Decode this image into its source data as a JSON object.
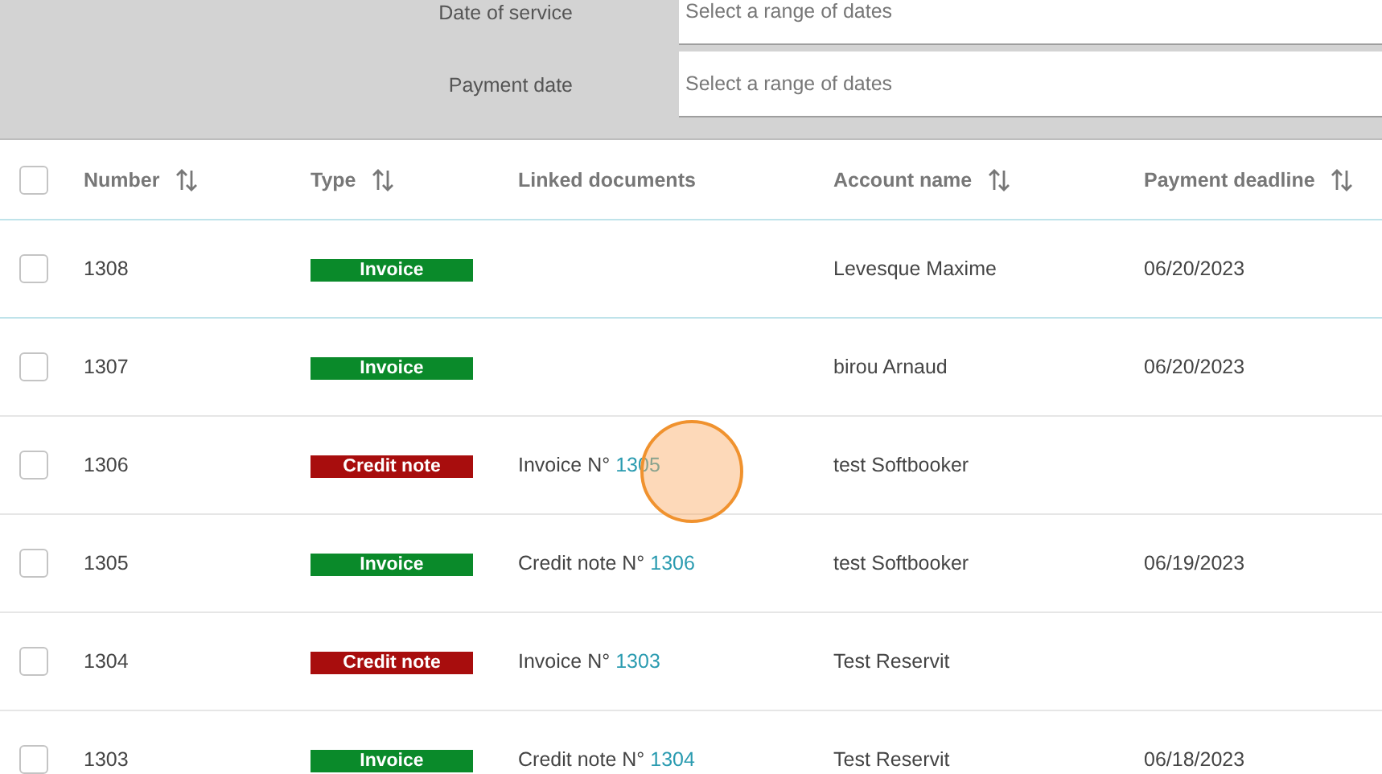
{
  "filters": [
    {
      "label": "Date of service",
      "placeholder": "Select a range of dates"
    },
    {
      "label": "Payment date",
      "placeholder": "Select a range of dates"
    }
  ],
  "table": {
    "select_all": {
      "checked": false
    },
    "columns": [
      {
        "label": "Number",
        "sortable": true
      },
      {
        "label": "Type",
        "sortable": true
      },
      {
        "label": "Linked documents",
        "sortable": false
      },
      {
        "label": "Account name",
        "sortable": true
      },
      {
        "label": "Payment deadline",
        "sortable": true
      }
    ],
    "rows": [
      {
        "checked": false,
        "number": "1308",
        "type": {
          "kind": "invoice",
          "label": "Invoice"
        },
        "account": "Levesque Maxime",
        "deadline": "06/20/2023"
      },
      {
        "checked": false,
        "number": "1307",
        "type": {
          "kind": "invoice",
          "label": "Invoice"
        },
        "account": "birou Arnaud",
        "deadline": "06/20/2023"
      },
      {
        "checked": false,
        "number": "1306",
        "type": {
          "kind": "credit",
          "label": "Credit note"
        },
        "linked": {
          "prefix": "Invoice N°",
          "link": "1305"
        },
        "account": "test Softbooker"
      },
      {
        "checked": false,
        "number": "1305",
        "type": {
          "kind": "invoice",
          "label": "Invoice"
        },
        "linked": {
          "prefix": "Credit note N°",
          "link": "1306"
        },
        "account": "test Softbooker",
        "deadline": "06/19/2023"
      },
      {
        "checked": false,
        "number": "1304",
        "type": {
          "kind": "credit",
          "label": "Credit note"
        },
        "linked": {
          "prefix": "Invoice N°",
          "link": "1303"
        },
        "account": "Test Reservit"
      },
      {
        "checked": false,
        "number": "1303",
        "type": {
          "kind": "invoice",
          "label": "Invoice"
        },
        "linked": {
          "prefix": "Credit note N°",
          "link": "1304"
        },
        "account": "Test Reservit",
        "deadline": "06/18/2023"
      }
    ]
  }
}
